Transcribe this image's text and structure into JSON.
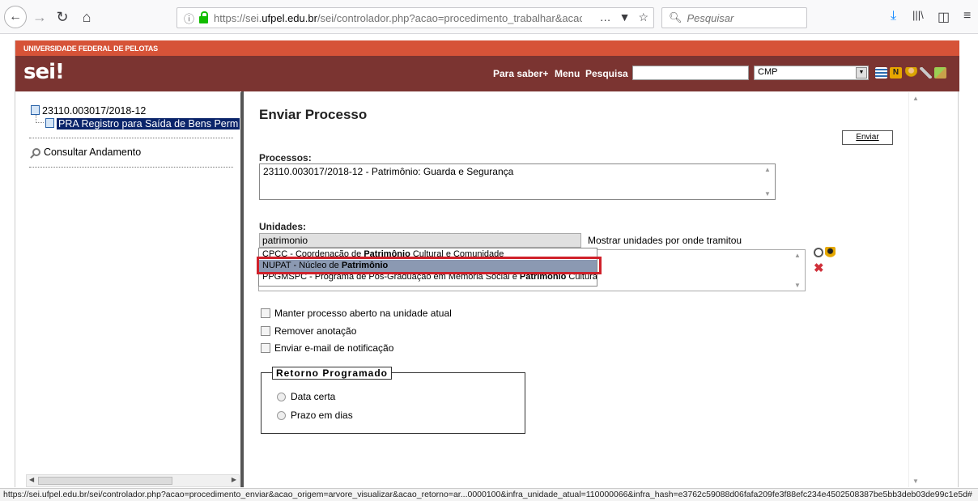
{
  "browser": {
    "url_prefix": "https://sei.",
    "url_domain": "ufpel.edu.br",
    "url_rest": "/sei/controlador.php?acao=procedimento_trabalhar&acao",
    "search_placeholder": "Pesquisar",
    "page_actions": "…",
    "status_url": "https://sei.ufpel.edu.br/sei/controlador.php?acao=procedimento_enviar&acao_origem=arvore_visualizar&acao_retorno=ar...0000100&infra_unidade_atual=110000066&infra_hash=e3762c59088d06fafa209fe3f88efc234e4502508387be5bb3deb03de99c1e5d#"
  },
  "header": {
    "institution": "UNIVERSIDADE FEDERAL DE PELOTAS",
    "logo": "sei",
    "logo_mark": "!",
    "links": [
      "Para saber+",
      "Menu",
      "Pesquisa"
    ],
    "search_value": "",
    "unit_select": "CMP",
    "colors": {
      "institution_bar": "#d65338",
      "header_bar": "#7b3431"
    }
  },
  "tree": {
    "process_number": "23110.003017/2018-12",
    "document_label": "PRA Registro para Saída de Bens Perm",
    "consult_label": "Consultar Andamento"
  },
  "main": {
    "title": "Enviar Processo",
    "send_button": "Enviar",
    "processes_label": "Processos:",
    "processes_value": "23110.003017/2018-12 - Patrimônio: Guarda e Segurança",
    "units_label": "Unidades:",
    "units_input": "patrimonio",
    "units_hint": "Mostrar unidades por onde tramitou",
    "suggestions": [
      {
        "pre": "CPCC - Coordenação de ",
        "match": "Patrimônio",
        "post": " Cultural e Comunidade"
      },
      {
        "pre": "NUPAT - Núcleo de ",
        "match": "Patrimônio",
        "post": ""
      },
      {
        "pre": "PPGMSPC - Programa de Pós-Graduação em Memória Social e ",
        "match": "Patrimônio",
        "post": " Cultural"
      }
    ],
    "selected_suggestion_index": 1,
    "options": [
      "Manter processo aberto na unidade atual",
      "Remover anotação",
      "Enviar e-mail de notificação"
    ],
    "return_legend": "Retorno Programado",
    "return_options": [
      "Data certa",
      "Prazo em dias"
    ],
    "highlight_color": "#d0202a"
  }
}
